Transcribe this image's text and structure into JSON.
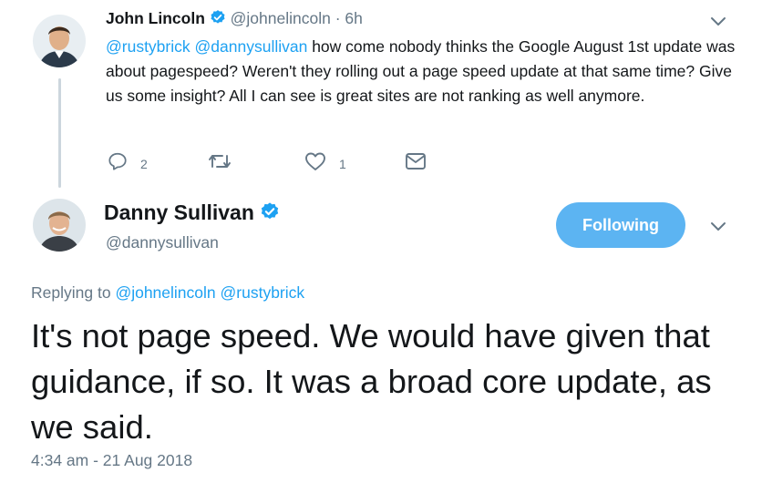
{
  "reply_tweet": {
    "author_name": "John Lincoln",
    "author_handle": "@johnelincoln",
    "time_sep": "·",
    "time": "6h",
    "mention_1": "@rustybrick",
    "mention_2": "@dannysullivan",
    "text": "how come nobody thinks the Google August 1st update was about pagespeed? Weren't they rolling out a page speed update at that same time? Give us some insight? All I can see is great sites are not ranking as well anymore.",
    "reply_count": "2",
    "retweet_count": "",
    "like_count": "1"
  },
  "main_tweet": {
    "author_name": "Danny Sullivan",
    "author_handle": "@dannysullivan",
    "follow_label": "Following",
    "replying_prefix": "Replying to",
    "replying_to_1": "@johnelincoln",
    "replying_to_2": "@rustybrick",
    "text": "It's not page speed. We would have given that guidance, if so. It was a broad core update, as we said.",
    "timestamp": "4:34 am - 21 Aug 2018"
  },
  "colors": {
    "accent": "#1da1f2",
    "follow_button": "#5cb4f2",
    "muted_text": "#657786",
    "thread_line": "#ccd6dd"
  },
  "icons": [
    "verified-badge-icon",
    "chevron-down-icon",
    "reply-icon",
    "retweet-icon",
    "like-icon",
    "direct-message-icon"
  ]
}
